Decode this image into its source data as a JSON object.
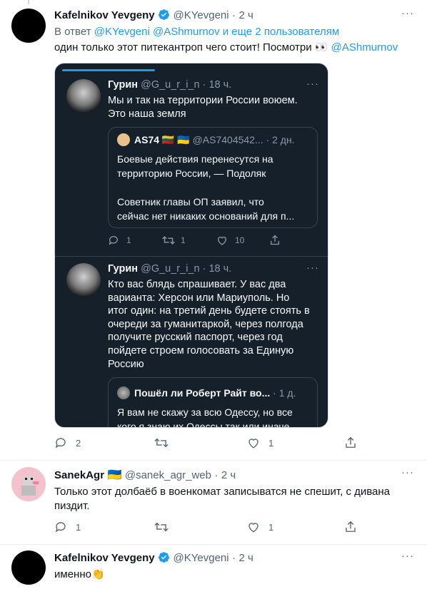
{
  "tweet1": {
    "name": "Kafelnikov Yevgeny",
    "handle": "@KYevgeni",
    "sep": "·",
    "time": "2 ч",
    "reply_prefix": "В ответ",
    "reply_users": "@KYevgeni @AShmurnov",
    "reply_more": " и еще 2 пользователям",
    "text_main": "один только этот питекантроп чего стоит! Посмотри",
    "text_emoji": "👀",
    "text_mention": "@AShmurnov",
    "counts": {
      "reply": "2",
      "like": "1"
    }
  },
  "shot": {
    "t1": {
      "name": "Гурин",
      "handle": "@G_u_r_i_n",
      "sep": "·",
      "time": "18 ч.",
      "text1": "Мы и так на территории России воюем.",
      "text2": "Это наша земля",
      "quote": {
        "name": "AS74",
        "flags": "🇱🇹 🇺🇦",
        "handle": "@AS7404542...",
        "sep": "·",
        "time": "2 дн.",
        "l1": "Боевые действия перенесутся на",
        "l2": "территорию России, — Подоляк",
        "l3": "Советник главы ОП заявил, что",
        "l4": "сейчас нет никаких оснований для п..."
      },
      "counts": {
        "reply": "1",
        "retweet": "1",
        "like": "10"
      }
    },
    "t2": {
      "name": "Гурин",
      "handle": "@G_u_r_i_n",
      "sep": "·",
      "time": "18 ч.",
      "lines": [
        "Кто вас блядь спрашивает. У вас два",
        "варианта: Херсон или Мариуполь. Но",
        "итог один: на третий день будете стоять в",
        "очереди за гуманитаркой, через полгода",
        "получите русский паспорт, через год",
        "пойдете строем голосовать за Единую",
        "Россию"
      ],
      "quote": {
        "name": "Пошёл ли Роберт Райт во...",
        "sep": "·",
        "time": "1 д.",
        "l1": "Я вам не скажу за всю Одессу, но все",
        "l2": "кого я знаю их Одессы так или иначе"
      }
    }
  },
  "tweet2": {
    "name": "SanekAgr",
    "flag": "🇺🇦",
    "handle": "@sanek_agr_web",
    "sep": "·",
    "time": "2 ч",
    "text1": "Только этот долбаёб в военкомат записыватся не спешит, с дивана",
    "text2": "пиздит.",
    "counts": {
      "reply": "1",
      "like": "1"
    }
  },
  "tweet3": {
    "name": "Kafelnikov Yevgeny",
    "handle": "@KYevgeni",
    "sep": "·",
    "time": "2 ч",
    "text": "именно",
    "emoji": "👏"
  },
  "colors": {
    "link": "#1d9bf0",
    "muted": "#536471",
    "dark_bg": "#15202b"
  }
}
